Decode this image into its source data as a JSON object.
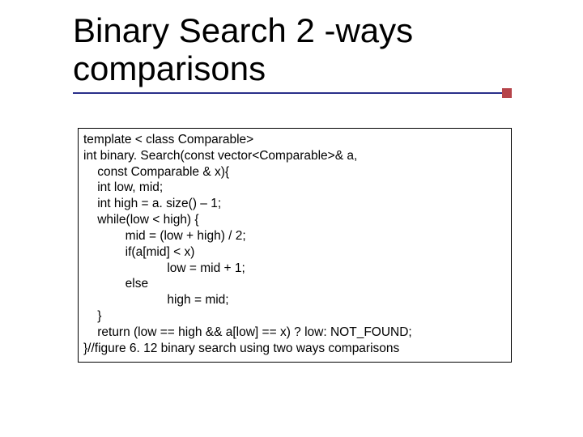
{
  "title": "Binary Search 2 -ways comparisons",
  "code": {
    "l01": "template < class Comparable>",
    "l02": "int binary. Search(const vector<Comparable>& a,",
    "l03": "    const Comparable & x){",
    "l04": "    int low, mid;",
    "l05": "    int high = a. size() – 1;",
    "l06": "    while(low < high) {",
    "l07": "            mid = (low + high) / 2;",
    "l08": "            if(a[mid] < x)",
    "l09": "                        low = mid + 1;",
    "l10": "            else",
    "l11": "                        high = mid;",
    "l12": "    }",
    "l13": "    return (low == high && a[low] == x) ? low: NOT_FOUND;",
    "l14": "}//figure 6. 12 binary search using two ways comparisons"
  }
}
